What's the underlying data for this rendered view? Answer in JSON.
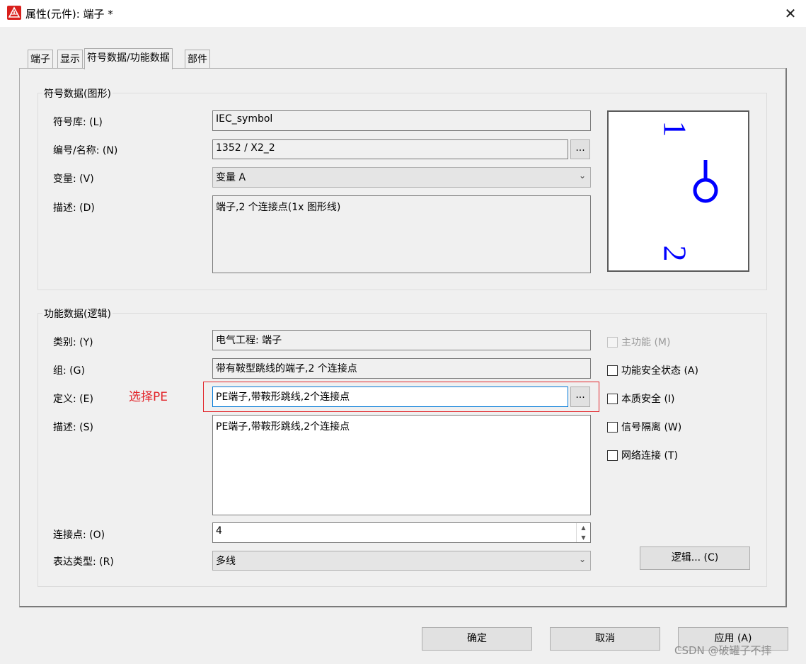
{
  "window": {
    "title": "属性(元件): 端子 *"
  },
  "tabs": [
    {
      "label": "端子"
    },
    {
      "label": "显示"
    },
    {
      "label": "符号数据/功能数据"
    },
    {
      "label": "部件"
    }
  ],
  "symbol_group": {
    "title": "符号数据(图形)",
    "library": {
      "label": "符号库: (L)",
      "value": "IEC_symbol"
    },
    "number_name": {
      "label": "编号/名称: (N)",
      "value": "1352 / X2_2",
      "browse": "..."
    },
    "variant": {
      "label": "变量: (V)",
      "value": "变量 A"
    },
    "description": {
      "label": "描述: (D)",
      "value": "端子,2 个连接点(1x 图形线)"
    },
    "preview": {
      "top_label": "1",
      "bottom_label": "2",
      "color": "#0000ff"
    }
  },
  "function_group": {
    "title": "功能数据(逻辑)",
    "category": {
      "label": "类别: (Y)",
      "value": "电气工程: 端子"
    },
    "group": {
      "label": "组: (G)",
      "value": "带有鞍型跳线的端子,2 个连接点"
    },
    "definition": {
      "label": "定义: (E)",
      "value": "PE端子,带鞍形跳线,2个连接点",
      "browse": "..."
    },
    "description": {
      "label": "描述: (S)",
      "value": "PE端子,带鞍形跳线,2个连接点"
    },
    "connection_points": {
      "label": "连接点: (O)",
      "value": "4"
    },
    "representation_type": {
      "label": "表达类型: (R)",
      "value": "多线"
    },
    "checkboxes": [
      {
        "label": "主功能 (M)",
        "checked": false,
        "disabled": true
      },
      {
        "label": "功能安全状态 (A)",
        "checked": false,
        "disabled": false
      },
      {
        "label": "本质安全 (I)",
        "checked": false,
        "disabled": false
      },
      {
        "label": "信号隔离 (W)",
        "checked": false,
        "disabled": false
      },
      {
        "label": "网络连接 (T)",
        "checked": false,
        "disabled": false
      }
    ],
    "logic_button": "逻辑... (C)"
  },
  "annotation": {
    "text": "选择PE",
    "color": "#e2262b"
  },
  "footer": {
    "ok": "确定",
    "cancel": "取消",
    "apply": "应用 (A)"
  },
  "watermark": "CSDN @破罐子不摔"
}
